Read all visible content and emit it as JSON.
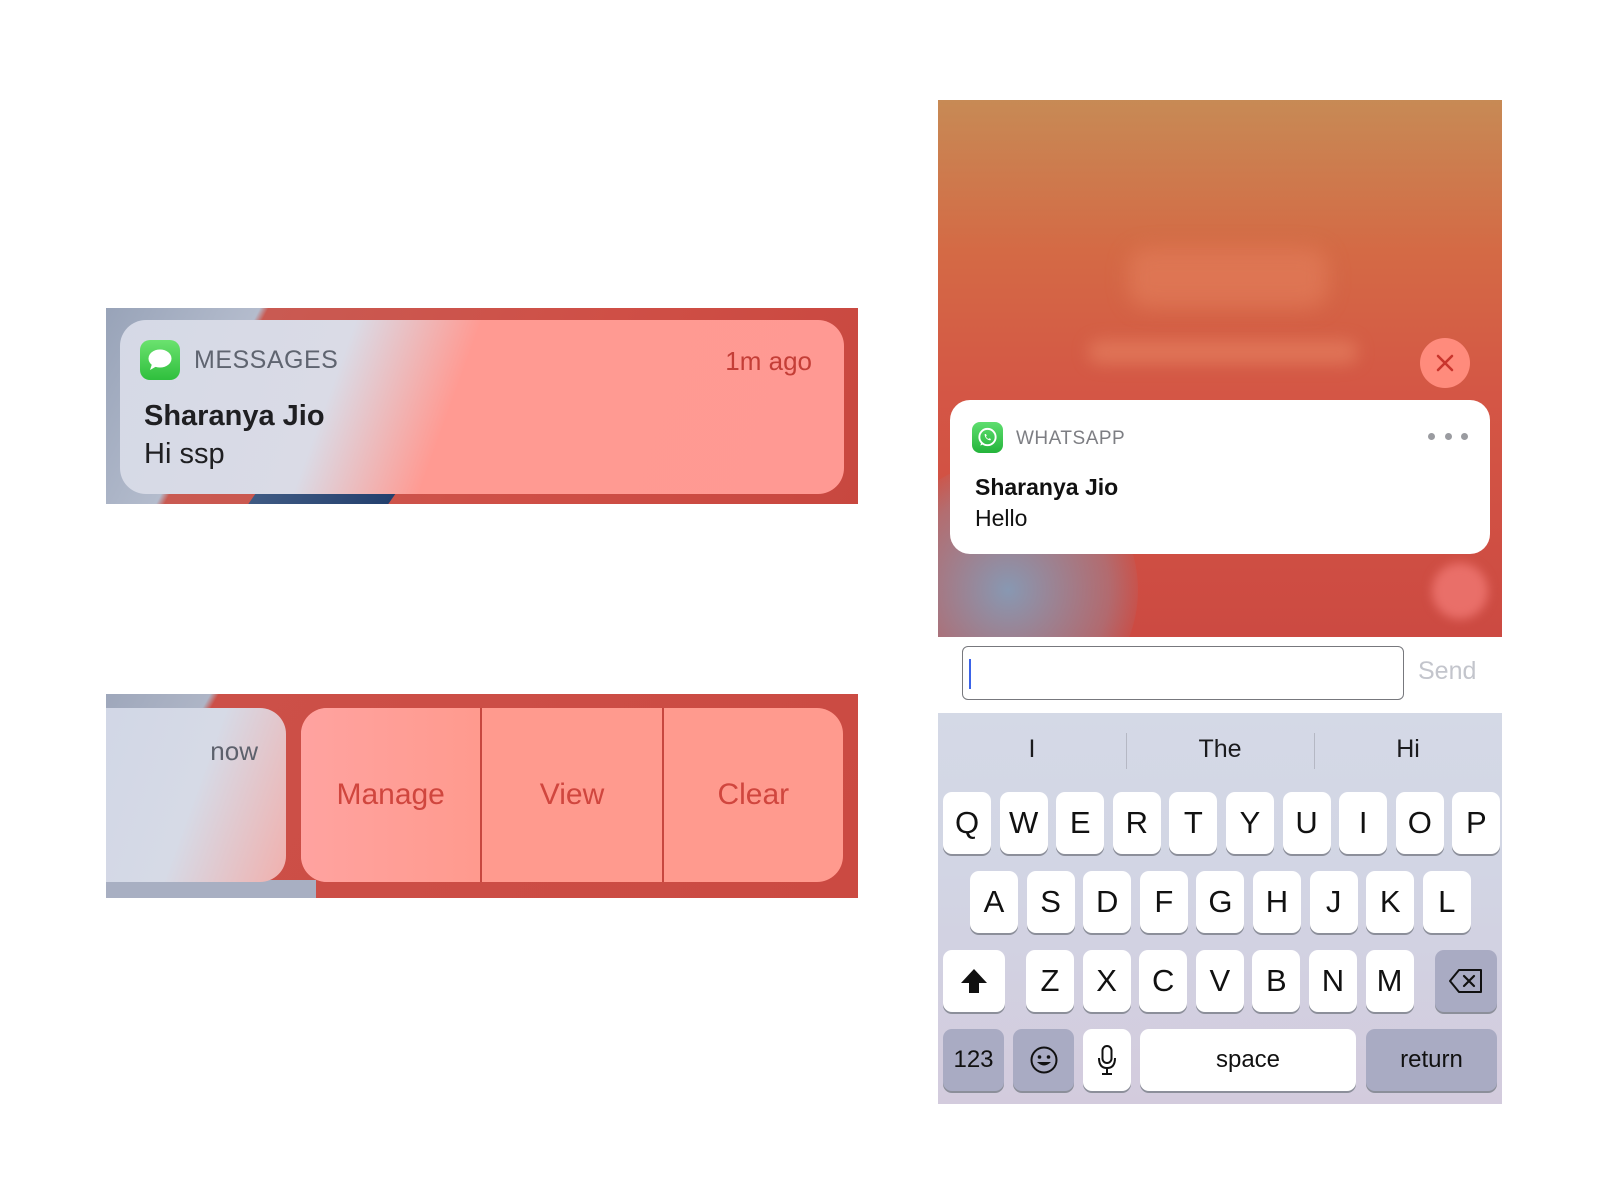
{
  "messages_notification": {
    "app_name": "MESSAGES",
    "time": "1m ago",
    "sender": "Sharanya Jio",
    "body": "Hi ssp",
    "icon": "messages-bubble-icon"
  },
  "swipe_actions": {
    "peek_time": "now",
    "actions": [
      "Manage",
      "View",
      "Clear"
    ]
  },
  "whatsapp_reply": {
    "app_name": "WHATSAPP",
    "sender": "Sharanya Jio",
    "body": "Hello",
    "icon": "whatsapp-icon",
    "input_value": "",
    "send_label": "Send",
    "suggestions": [
      "I",
      "The",
      "Hi"
    ],
    "keyboard": {
      "row1": [
        "Q",
        "W",
        "E",
        "R",
        "T",
        "Y",
        "U",
        "I",
        "O",
        "P"
      ],
      "row2": [
        "A",
        "S",
        "D",
        "F",
        "G",
        "H",
        "J",
        "K",
        "L"
      ],
      "row3": [
        "Z",
        "X",
        "C",
        "V",
        "B",
        "N",
        "M"
      ],
      "numbers_label": "123",
      "space_label": "space",
      "return_label": "return"
    }
  },
  "colors": {
    "notification_red": "#cf4f46",
    "action_text": "#d0463e",
    "caret_blue": "#3b63e8"
  }
}
